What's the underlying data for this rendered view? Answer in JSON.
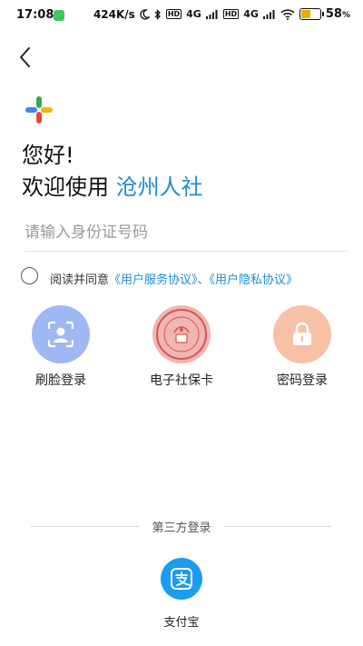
{
  "status_bar": {
    "time": "17:08",
    "network_speed": "424K/s",
    "network_type_1": "4G",
    "network_type_2": "4G",
    "battery_percent": "58",
    "battery_unit": "%",
    "battery_level": 0.58,
    "colors": {
      "app_badge": "#3cc85f",
      "battery_fill": "#f0a800"
    }
  },
  "header": {
    "back_icon": "chevron-left-icon"
  },
  "greeting": {
    "line1": "您好!",
    "line2_prefix": "欢迎使用",
    "brand": "沧州人社",
    "brand_color": "#1f8bd6"
  },
  "id_input": {
    "placeholder": "请输入身份证号码",
    "value": ""
  },
  "agreement": {
    "prefix": "阅读并同意",
    "link1": "《用户服务协议》",
    "separator": "、",
    "link2": "《用户隐私协议》",
    "checked": false
  },
  "login_options": {
    "face": {
      "label": "刷脸登录",
      "icon": "face-scan-icon",
      "color": "#9fb7f3"
    },
    "card": {
      "label": "电子社保卡",
      "icon": "social-security-card-icon",
      "color": "#f0b6b2"
    },
    "password": {
      "label": "密码登录",
      "icon": "lock-icon",
      "color": "#f6c1a6"
    }
  },
  "third_party": {
    "title": "第三方登录",
    "alipay": {
      "label": "支付宝",
      "icon": "alipay-icon",
      "color": "#1d9bf0"
    }
  }
}
